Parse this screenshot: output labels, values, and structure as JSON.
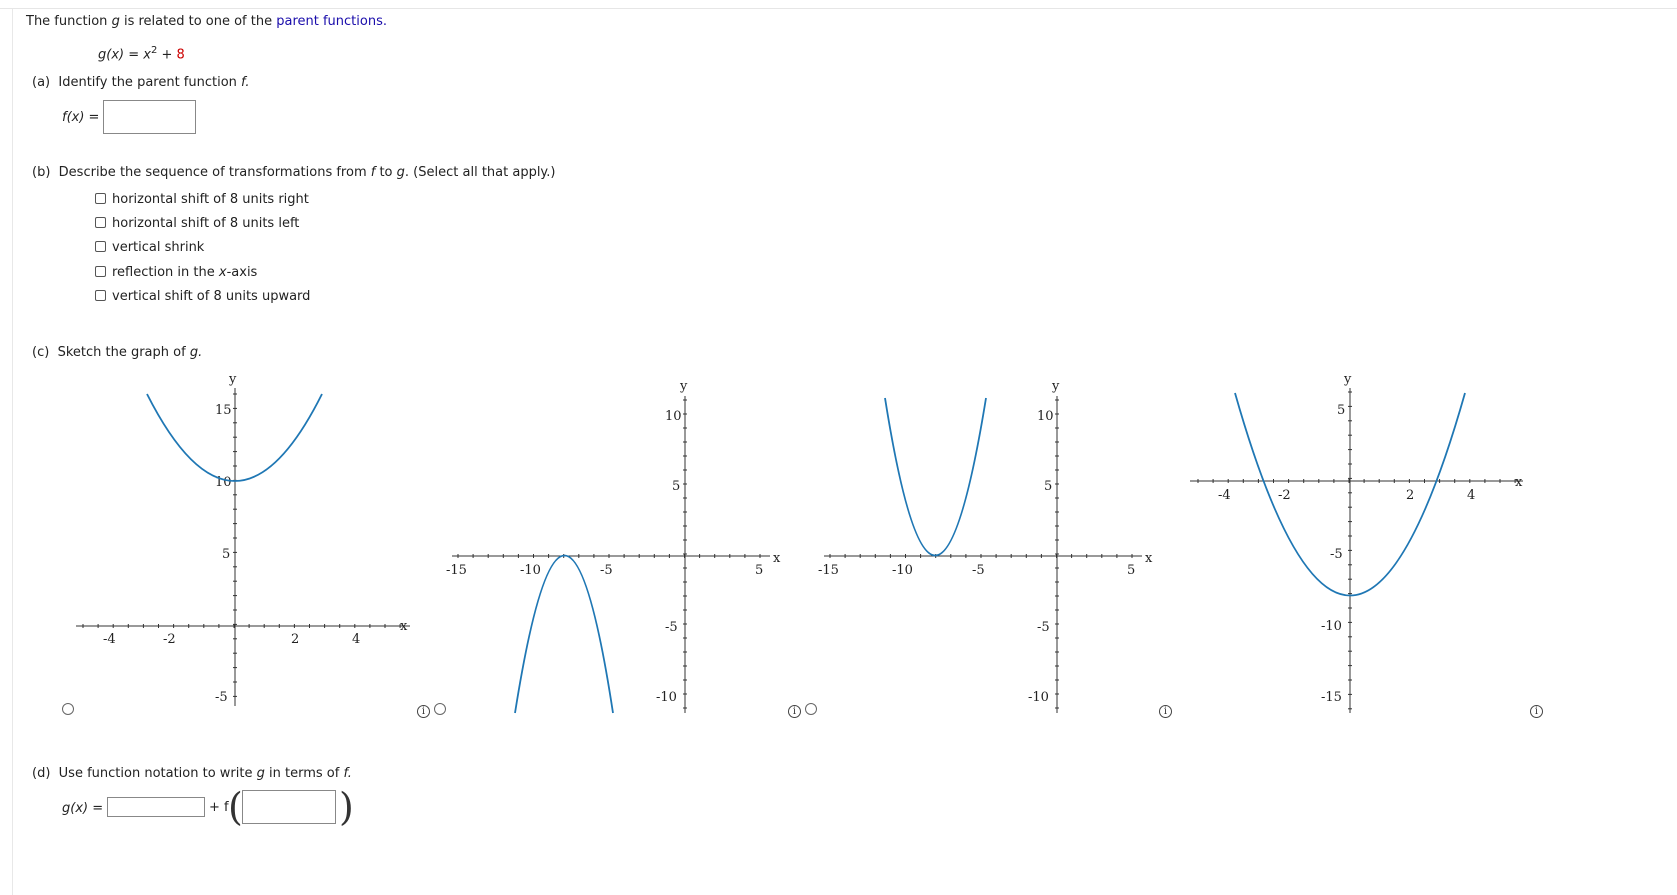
{
  "intro": {
    "text_before": "The function ",
    "var": "g",
    "text_middle": " is related to one of the ",
    "link": "parent functions."
  },
  "given": {
    "lhs": "g(x) = x",
    "exp": "2",
    "plus": " + ",
    "const": "8"
  },
  "part_a": {
    "letter": "(a)",
    "text": "Identify the parent function ",
    "var": "f.",
    "answer_label": "f(x) =",
    "answer_value": ""
  },
  "part_b": {
    "letter": "(b)",
    "text1": "Describe the sequence of transformations from ",
    "f": "f",
    "text2": " to ",
    "g": "g",
    "text3": ". (Select all that apply.)",
    "options": [
      {
        "label": "horizontal shift of 8 units right",
        "checked": false
      },
      {
        "label": "horizontal shift of 8 units left",
        "checked": false
      },
      {
        "label": "vertical shrink",
        "checked": false
      },
      {
        "label_pre": "reflection in the ",
        "label_var": "x",
        "label_post": "-axis",
        "checked": false
      },
      {
        "label": "vertical shift of 8 units upward",
        "checked": false
      }
    ]
  },
  "part_c": {
    "letter": "(c)",
    "text": "Sketch the graph of ",
    "var": "g."
  },
  "part_d": {
    "letter": "(d)",
    "text": "Use function notation to write ",
    "g": "g",
    "text2": " in terms of ",
    "f": "f.",
    "g_label": "g(x) =",
    "plus_f": "+ f",
    "box1_value": "",
    "box2_value": ""
  },
  "graphs": [
    {
      "xlabel": "x",
      "ylabel": "y",
      "xticks": [
        "-4",
        "-2",
        "2",
        "4"
      ],
      "yticks": [
        "15",
        "10",
        "5",
        "-5"
      ],
      "selected": false
    },
    {
      "xlabel": "x",
      "ylabel": "y",
      "xticks": [
        "-15",
        "-10",
        "-5",
        "5"
      ],
      "yticks": [
        "10",
        "5",
        "-5",
        "-10"
      ],
      "selected": false
    },
    {
      "xlabel": "x",
      "ylabel": "y",
      "xticks": [
        "-15",
        "-10",
        "-5",
        "5"
      ],
      "yticks": [
        "10",
        "5",
        "-5",
        "-10"
      ],
      "selected": false
    },
    {
      "xlabel": "x",
      "ylabel": "y",
      "xticks": [
        "-4",
        "-2",
        "2",
        "4"
      ],
      "yticks": [
        "5",
        "-5",
        "-10",
        "-15"
      ],
      "selected": false
    }
  ],
  "colors": {
    "curve": "#1f77b4",
    "link": "#1a0dab",
    "const": "#cc0000"
  },
  "icons": {
    "info": "info-icon",
    "radio": "radio-button"
  }
}
